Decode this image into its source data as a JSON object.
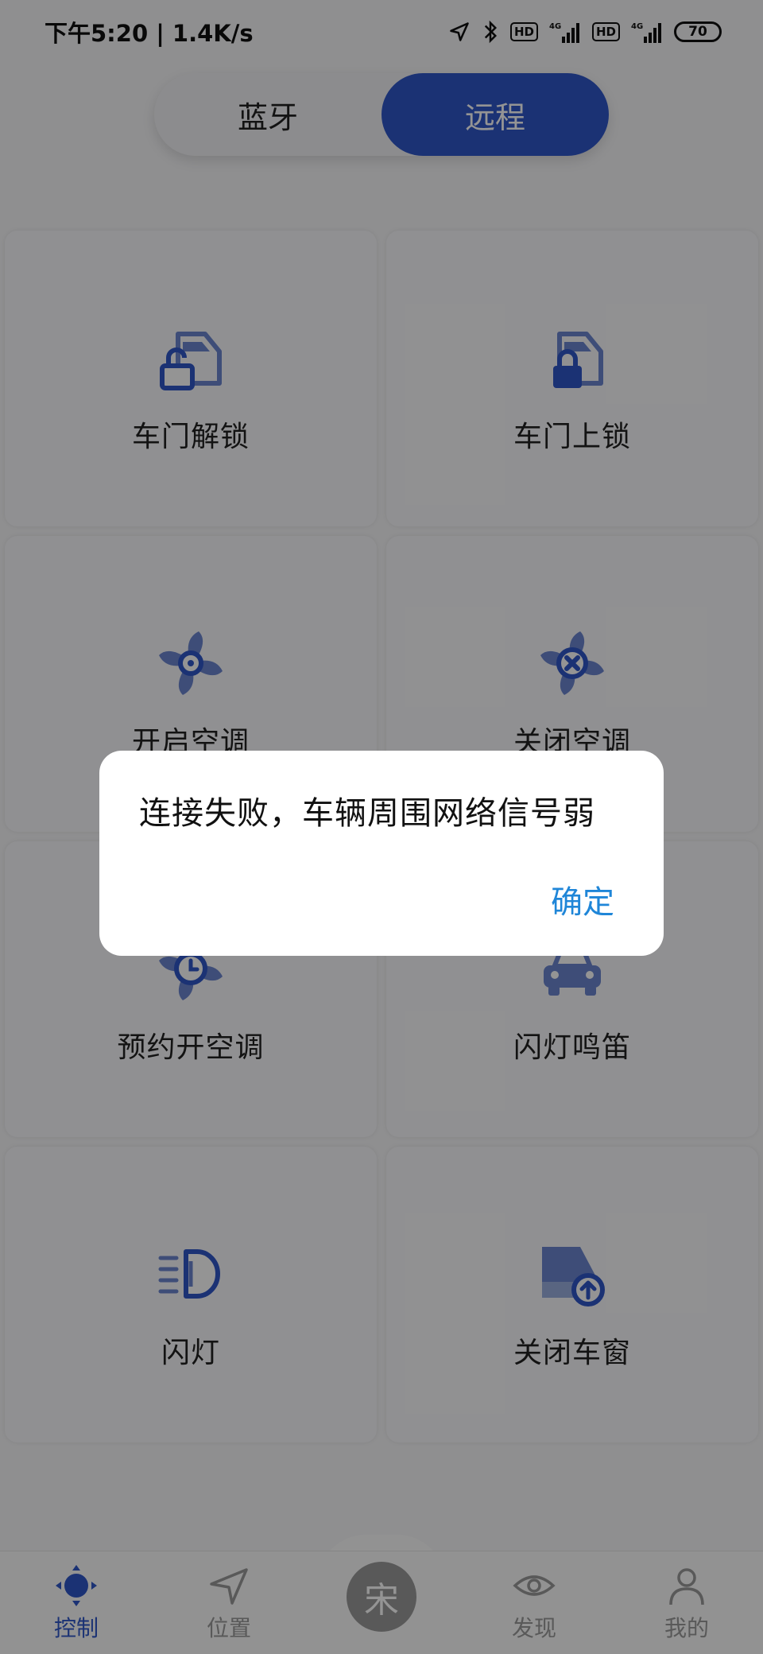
{
  "status_bar": {
    "time_speed": "下午5:20 | 1.4K/s",
    "hd1": "HD",
    "net1": "4G",
    "hd2": "HD",
    "net2": "4G",
    "battery": "70"
  },
  "segment": {
    "left_label": "蓝牙",
    "right_label": "远程",
    "selected": "远程"
  },
  "controls": [
    {
      "label": "车门解锁",
      "icon": "door-unlock-icon"
    },
    {
      "label": "车门上锁",
      "icon": "door-lock-icon"
    },
    {
      "label": "开启空调",
      "icon": "fan-on-icon"
    },
    {
      "label": "关闭空调",
      "icon": "fan-off-icon"
    },
    {
      "label": "预约开空调",
      "icon": "fan-schedule-icon"
    },
    {
      "label": "闪灯鸣笛",
      "icon": "car-horn-icon"
    },
    {
      "label": "闪灯",
      "icon": "headlight-icon"
    },
    {
      "label": "关闭车窗",
      "icon": "window-close-icon"
    }
  ],
  "tabbar": {
    "tabs": [
      {
        "label": "控制",
        "icon": "control-icon"
      },
      {
        "label": "位置",
        "icon": "location-arrow-icon"
      },
      {
        "label": "发现",
        "icon": "eye-icon"
      },
      {
        "label": "我的",
        "icon": "person-icon"
      }
    ],
    "center_glyph": "宋",
    "active": "控制"
  },
  "dialog": {
    "message": "连接失败，车辆周围网络信号弱",
    "confirm_label": "确定"
  },
  "colors": {
    "accent": "#2f56c8",
    "icon_light": "#6b86cf",
    "dialog_button": "#1f86d8"
  }
}
